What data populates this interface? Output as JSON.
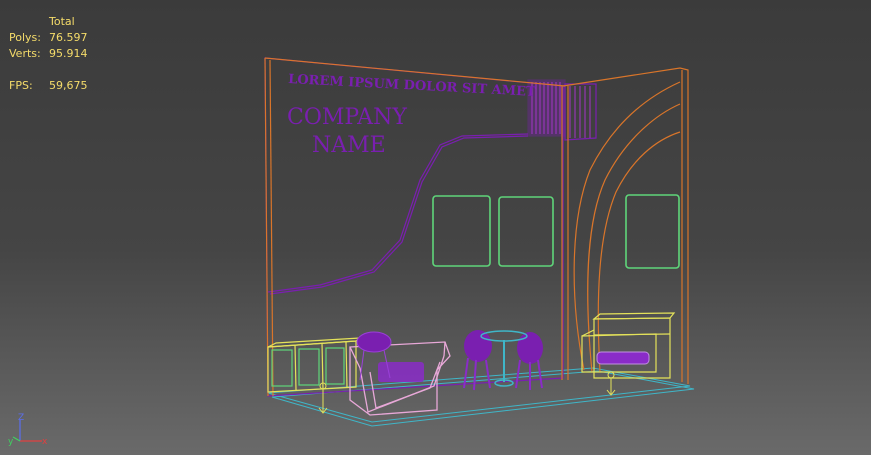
{
  "stats": {
    "header": "Total",
    "polys_label": "Polys:",
    "polys_value": "76.597",
    "verts_label": "Verts:",
    "verts_value": "95.914",
    "fps_label": "FPS:",
    "fps_value": "59,675"
  },
  "booth": {
    "slogan": "LOREM IPSUM DOLOR SIT AMET",
    "company_line1": "COMPANY",
    "company_line2": "NAME"
  },
  "gizmo": {
    "z": "Z",
    "y": "y",
    "x": "x"
  },
  "colors": {
    "wire_purple": "#7a1fb0",
    "wire_orange": "#d9752a",
    "wire_green": "#5fd67a",
    "wire_yellow": "#e4e25a",
    "wire_pink": "#e8a8d8",
    "wire_cyan": "#3fb6c8",
    "text_yellow": "#f5dc6a"
  }
}
